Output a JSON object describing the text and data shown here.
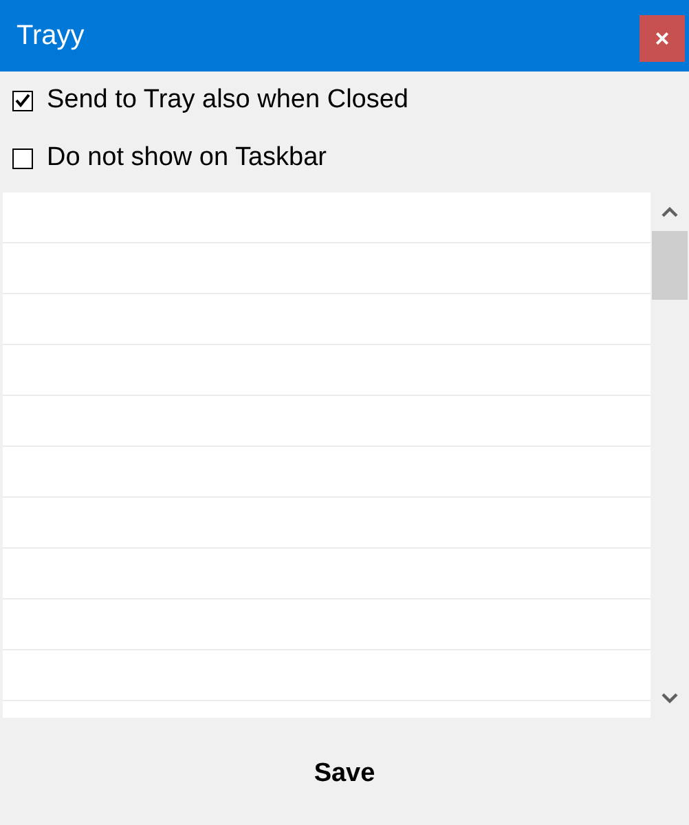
{
  "window": {
    "title": "Trayy",
    "close_label": "×"
  },
  "options": [
    {
      "label": "Send to Tray also when Closed",
      "checked": true
    },
    {
      "label": "Do not show on Taskbar",
      "checked": false
    }
  ],
  "buttons": [
    "Save"
  ]
}
